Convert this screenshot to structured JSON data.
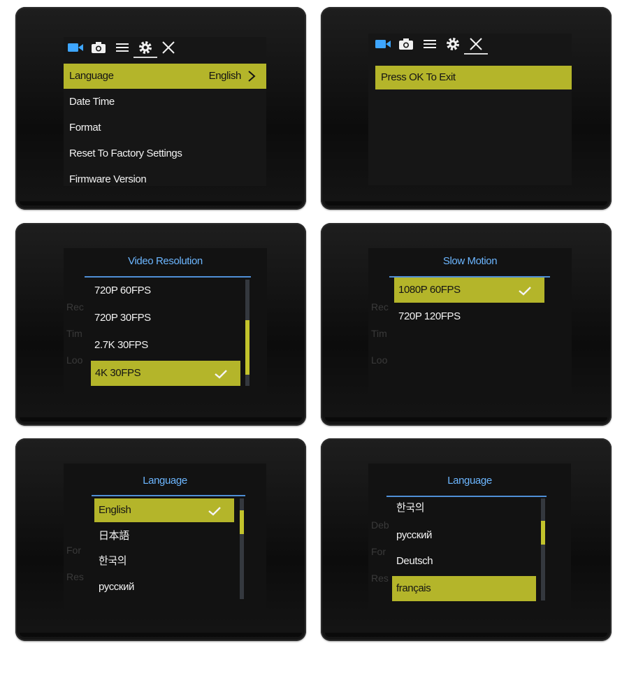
{
  "panels": {
    "settings": {
      "tabs": [
        "video-icon",
        "camera-icon",
        "menu-icon",
        "gear-icon",
        "close-icon"
      ],
      "items": [
        {
          "label": "Language",
          "value": "English"
        },
        {
          "label": "Date Time"
        },
        {
          "label": "Format"
        },
        {
          "label": "Reset To Factory Settings"
        },
        {
          "label": "Firmware Version"
        }
      ]
    },
    "exit": {
      "tabs": [
        "video-icon",
        "camera-icon",
        "menu-icon",
        "gear-icon",
        "close-icon"
      ],
      "message": "Press OK To Exit"
    },
    "video_resolution": {
      "title": "Video Resolution",
      "options": [
        "720P 60FPS",
        "720P 30FPS",
        "2.7K 30FPS",
        "4K 30FPS"
      ],
      "selected": "4K 30FPS"
    },
    "slow_motion": {
      "title": "Slow Motion",
      "options": [
        "1080P 60FPS",
        "720P 120FPS"
      ],
      "selected": "1080P 60FPS"
    },
    "language1": {
      "title": "Language",
      "options": [
        "English",
        "日本語",
        "한국의",
        "русский"
      ],
      "selected": "English"
    },
    "language2": {
      "title": "Language",
      "options": [
        "한국의",
        "русский",
        "Deutsch",
        "français"
      ],
      "selected": "français"
    }
  },
  "colors": {
    "highlight": "#b4b52a",
    "title": "#6cb6ff",
    "scroll": "#c2c32c"
  }
}
